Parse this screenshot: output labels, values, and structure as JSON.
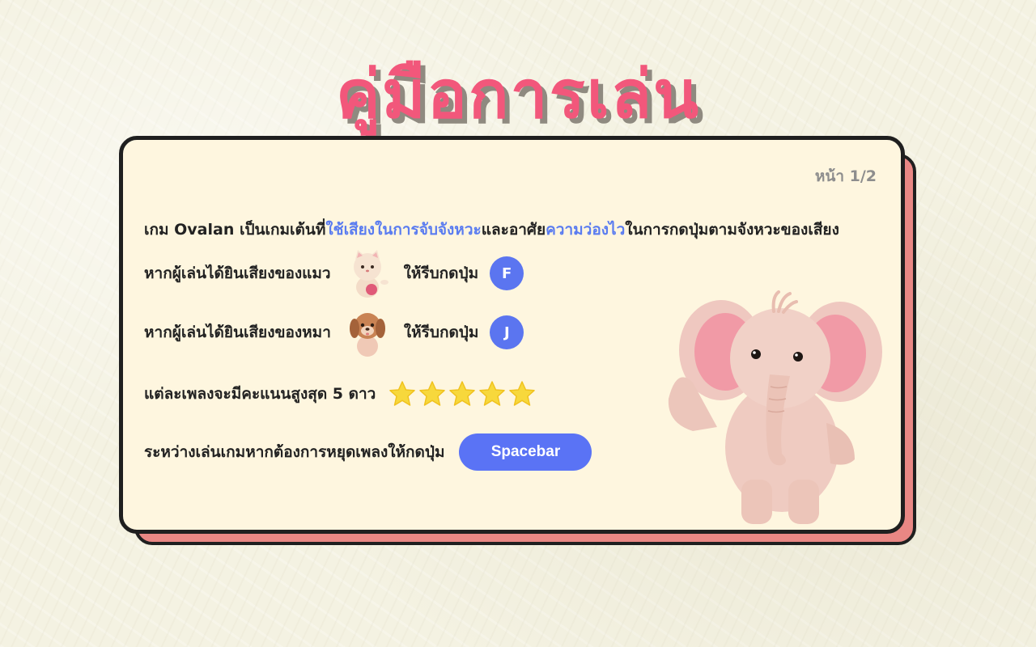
{
  "title": "คู่มือการเล่น",
  "page_indicator": "หน้า 1/2",
  "intro": {
    "part1": "เกม Ovalan เป็นเกมเต้นที่",
    "highlight1": "ใช้เสียงในการจับจังหวะ",
    "part2": "และอาศัย",
    "highlight2": "ความว่องไว",
    "part3": "ในการกดปุ่มตามจังหวะของเสียง"
  },
  "rules": {
    "cat_text": "หากผู้เล่นได้ยินเสียงของแมว",
    "cat_action": "ให้รีบกดปุ่ม",
    "cat_key": "F",
    "dog_text": "หากผู้เล่นได้ยินเสียงของหมา",
    "dog_action": "ให้รีบกดปุ่ม",
    "dog_key": "J",
    "stars_text": "แต่ละเพลงจะมีคะแนนสูงสุด 5 ดาว",
    "stars_count": 5,
    "pause_text": "ระหว่างเล่นเกมหากต้องการหยุดเพลงให้กดปุ่ม",
    "pause_key": "Spacebar"
  },
  "colors": {
    "title": "#f2577b",
    "highlight": "#5a7cf0",
    "key_button": "#5b75f0",
    "card_bg": "#fef6df",
    "card_shadow": "#e98784",
    "star": "#f7d83c"
  },
  "icons": {
    "cat": "cat-icon",
    "dog": "dog-icon",
    "star": "star-icon",
    "mascot": "elephant-mascot"
  }
}
